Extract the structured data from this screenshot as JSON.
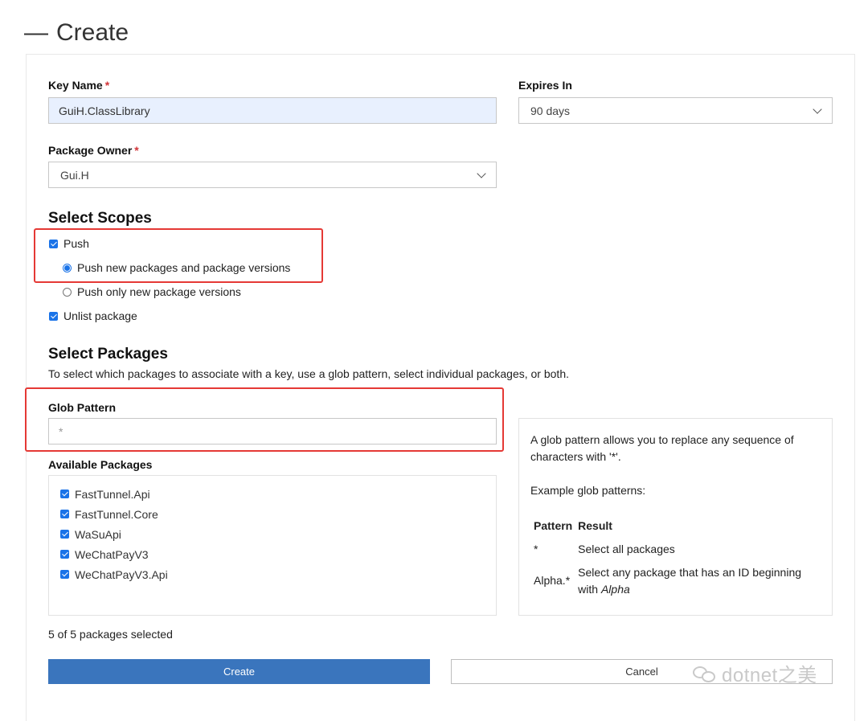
{
  "header": {
    "collapse_glyph": "—",
    "title": "Create"
  },
  "form": {
    "key_name": {
      "label": "Key Name",
      "required": "*",
      "value": "GuiH.ClassLibrary"
    },
    "expires_in": {
      "label": "Expires In",
      "value": "90 days"
    },
    "package_owner": {
      "label": "Package Owner",
      "required": "*",
      "value": "Gui.H"
    }
  },
  "scopes": {
    "heading": "Select Scopes",
    "push_label": "Push",
    "push_new_label": "Push new packages and package versions",
    "push_only_label": "Push only new package versions",
    "unlist_label": "Unlist package"
  },
  "packages": {
    "heading": "Select Packages",
    "description": "To select which packages to associate with a key, use a glob pattern, select individual packages, or both.",
    "glob_label": "Glob Pattern",
    "glob_placeholder": "*",
    "available_label": "Available Packages",
    "items": [
      "FastTunnel.Api",
      "FastTunnel.Core",
      "WaSuApi",
      "WeChatPayV3",
      "WeChatPayV3.Api"
    ],
    "selected_count": "5 of 5 packages selected"
  },
  "help": {
    "line1": "A glob pattern allows you to replace any sequence of characters with '*'.",
    "line2": "Example glob patterns:",
    "col_pattern": "Pattern",
    "col_result": "Result",
    "rows": [
      {
        "pattern": "*",
        "result": "Select all packages"
      },
      {
        "pattern": "Alpha.*",
        "result_prefix": "Select any package that has an ID beginning with ",
        "result_em": "Alpha"
      }
    ]
  },
  "actions": {
    "create_label": "Create",
    "cancel_label": "Cancel"
  },
  "watermark": {
    "text": "dotnet之美"
  },
  "colors": {
    "accent": "#1a73e8",
    "primary_button": "#3a75bd",
    "highlight": "#e53935",
    "required": "#d13438"
  }
}
